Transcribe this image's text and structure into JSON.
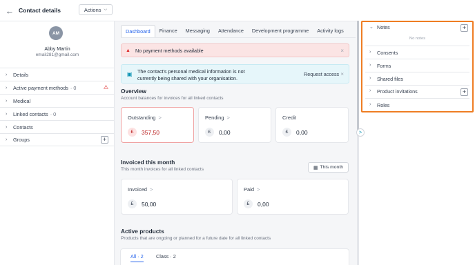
{
  "header": {
    "back_icon": "arrow-left-icon",
    "title": "Contact details",
    "actions_label": "Actions"
  },
  "profile": {
    "initials": "AM",
    "name": "Abby Martin",
    "email": "email281@gmail.com"
  },
  "sidebar": {
    "items": [
      {
        "label": "Details",
        "count": ""
      },
      {
        "label": "Active payment methods",
        "count": "· 0"
      },
      {
        "label": "Medical",
        "count": ""
      },
      {
        "label": "Linked contacts",
        "count": "· 0"
      },
      {
        "label": "Contacts",
        "count": ""
      },
      {
        "label": "Groups",
        "count": ""
      }
    ]
  },
  "tabs": [
    "Dashboard",
    "Finance",
    "Messaging",
    "Attendance",
    "Development programme",
    "Activity logs"
  ],
  "alerts": {
    "payment": "No payment methods available",
    "medical": "The contact's personal medical information is not currently being shared with your organisation.",
    "request_access": "Request access"
  },
  "overview": {
    "title": "Overview",
    "subtitle": "Account balances for invoices for all linked contacts",
    "currency_symbol": "£",
    "cards": [
      {
        "label": "Outstanding",
        "value": "357,50"
      },
      {
        "label": "Pending",
        "value": "0,00"
      },
      {
        "label": "Credit",
        "value": "0,00"
      }
    ]
  },
  "invoiced": {
    "title": "Invoiced this month",
    "subtitle": "This month invoices for all linked contacts",
    "filter_label": "This month",
    "cards": [
      {
        "label": "Invoiced",
        "value": "50,00"
      },
      {
        "label": "Paid",
        "value": "0,00"
      }
    ]
  },
  "products": {
    "title": "Active products",
    "subtitle": "Products that are ongoing or planned for a future date for all linked contacts",
    "tabs": [
      "All · 2",
      "Class · 2"
    ]
  },
  "right_panel": {
    "notes_label": "Notes",
    "no_notes": "No notes",
    "items": [
      "Consents",
      "Forms",
      "Shared files",
      "Product invitations",
      "Roles"
    ]
  },
  "colors": {
    "accent": "#2563eb",
    "danger": "#dc2626",
    "highlight_border": "#ef7d23"
  }
}
